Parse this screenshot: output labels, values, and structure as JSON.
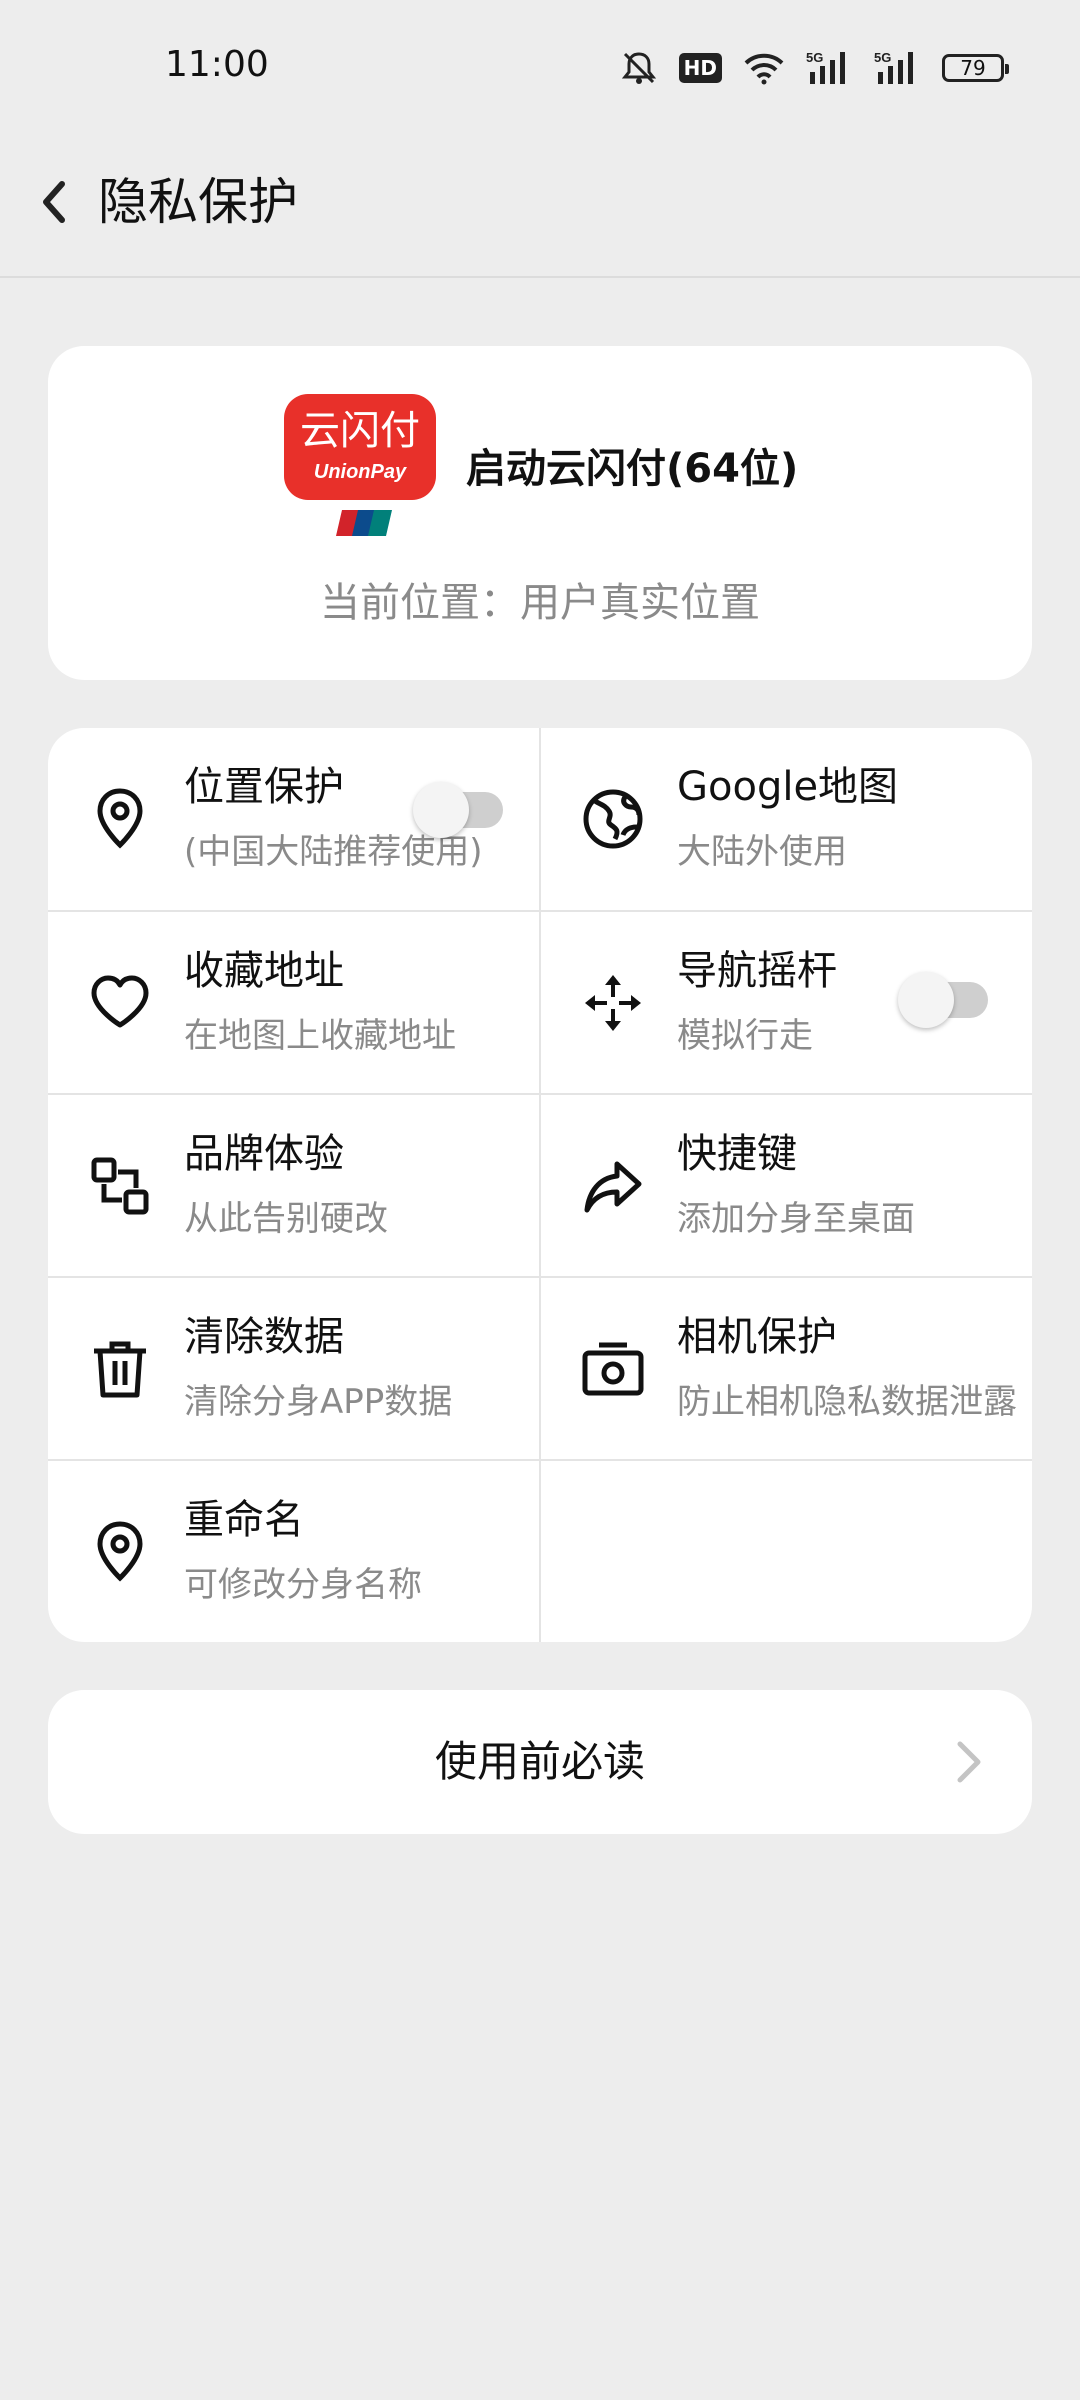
{
  "status_bar": {
    "time": "11:00",
    "hd_label": "HD",
    "network_1": "5G",
    "network_2": "5G",
    "battery": "79",
    "icons": [
      "mute-icon",
      "hd-icon",
      "wifi-icon",
      "signal-5g-icon",
      "signal-5g-icon",
      "battery-icon"
    ]
  },
  "header": {
    "back_icon": "chevron-left-icon",
    "title": "隐私保护"
  },
  "app_card": {
    "logo_text": "云闪付",
    "logo_sub": "UnionPay",
    "app_name": "启动云闪付(64位)",
    "location": "当前位置：用户真实位置"
  },
  "grid": {
    "items": [
      {
        "title": "位置保护",
        "subtitle": "(中国大陆推荐使用)",
        "icon": "location-pin-icon",
        "toggle": false
      },
      {
        "title": "Google地图",
        "subtitle": "大陆外使用",
        "icon": "globe-icon"
      },
      {
        "title": "收藏地址",
        "subtitle": "在地图上收藏地址",
        "icon": "heart-icon"
      },
      {
        "title": "导航摇杆",
        "subtitle": "模拟行走",
        "icon": "move-arrows-icon",
        "toggle": false
      },
      {
        "title": "品牌体验",
        "subtitle": "从此告别硬改",
        "icon": "swap-squares-icon"
      },
      {
        "title": "快捷键",
        "subtitle": "添加分身至桌面",
        "icon": "share-arrow-icon"
      },
      {
        "title": "清除数据",
        "subtitle": "清除分身APP数据",
        "icon": "trash-icon"
      },
      {
        "title": "相机保护",
        "subtitle": "防止相机隐私数据泄露",
        "icon": "camera-icon"
      },
      {
        "title": "重命名",
        "subtitle": "可修改分身名称",
        "icon": "location-pin-icon"
      }
    ]
  },
  "read_first": {
    "label": "使用前必读",
    "icon": "chevron-right-icon"
  },
  "colors": {
    "background": "#ededed",
    "card": "#ffffff",
    "subtitle": "#8a8a8a",
    "logo_red": "#e8302a"
  }
}
